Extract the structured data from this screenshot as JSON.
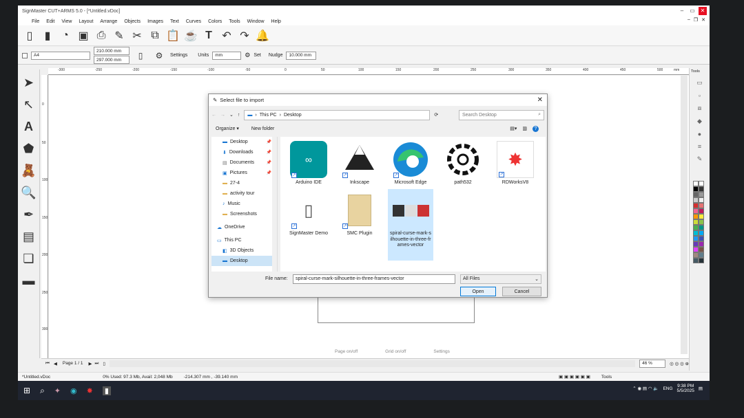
{
  "app": {
    "title": "SignMaster CUT+ARMS 5.0 - [*Untitled.vDoc]"
  },
  "menu": [
    "File",
    "Edit",
    "View",
    "Layout",
    "Arrange",
    "Objects",
    "Images",
    "Text",
    "Curves",
    "Colors",
    "Tools",
    "Window",
    "Help"
  ],
  "toolbar2": {
    "paper": "A4",
    "width": "210.000 mm",
    "height": "297.000 mm",
    "settings_label": "Settings",
    "units_label": "Units",
    "units_value": "mm",
    "set_label": "Set",
    "nudge_label": "Nudge",
    "nudge_value": "10.000 mm"
  },
  "ruler_top_ticks": [
    "-300",
    "-250",
    "-200",
    "-150",
    "-100",
    "-50",
    "0",
    "50",
    "100",
    "150",
    "200",
    "250",
    "300",
    "350",
    "400",
    "450",
    "500"
  ],
  "ruler_right_extra": "mm",
  "ruler_left_ticks": [
    "0",
    "50",
    "100",
    "150",
    "200",
    "250",
    "300"
  ],
  "canvas_footer": [
    "Page on/off",
    "Grid on/off",
    "Settings"
  ],
  "dialog": {
    "title": "Select file to import",
    "breadcrumb": [
      "This PC",
      "Desktop"
    ],
    "search_placeholder": "Search Desktop",
    "organize": "Organize ▾",
    "new_folder": "New folder",
    "nav_items": [
      {
        "label": "Desktop",
        "pinned": true
      },
      {
        "label": "Downloads",
        "pinned": true
      },
      {
        "label": "Documents",
        "pinned": true
      },
      {
        "label": "Pictures",
        "pinned": true
      },
      {
        "label": "27-4",
        "pinned": false
      },
      {
        "label": "activity tour",
        "pinned": false
      },
      {
        "label": "Music",
        "pinned": false
      },
      {
        "label": "Screenshots",
        "pinned": false
      },
      {
        "label": "OneDrive",
        "pinned": false
      },
      {
        "label": "This PC",
        "pinned": false
      },
      {
        "label": "3D Objects",
        "pinned": false
      },
      {
        "label": "Desktop",
        "pinned": false
      }
    ],
    "files": [
      {
        "label": "Arduino IDE"
      },
      {
        "label": "Inkscape"
      },
      {
        "label": "Microsoft Edge"
      },
      {
        "label": "path532"
      },
      {
        "label": "RDWorksV8"
      },
      {
        "label": "SignMaster Demo"
      },
      {
        "label": "SMC Plugin"
      },
      {
        "label": "spiral-curse-mark-silhouette-in-three-frames-vector"
      }
    ],
    "file_name_label": "File name:",
    "file_name_value": "spiral-curse-mark-silhouette-in-three-frames-vector",
    "file_type": "All Files",
    "open_label": "Open",
    "cancel_label": "Cancel"
  },
  "status": {
    "page": "Page 1 / 1",
    "zoom": "46 %",
    "doc": "*Untitled.vDoc",
    "memory": "0%  Used: 97.3 Mb, Avail: 2,048 Mb",
    "coords": "-214.307 mm , -39.140 mm",
    "tools": "Tools"
  },
  "taskbar": {
    "lang": "ENG",
    "time": "9:38 PM",
    "date": "5/5/2025"
  }
}
